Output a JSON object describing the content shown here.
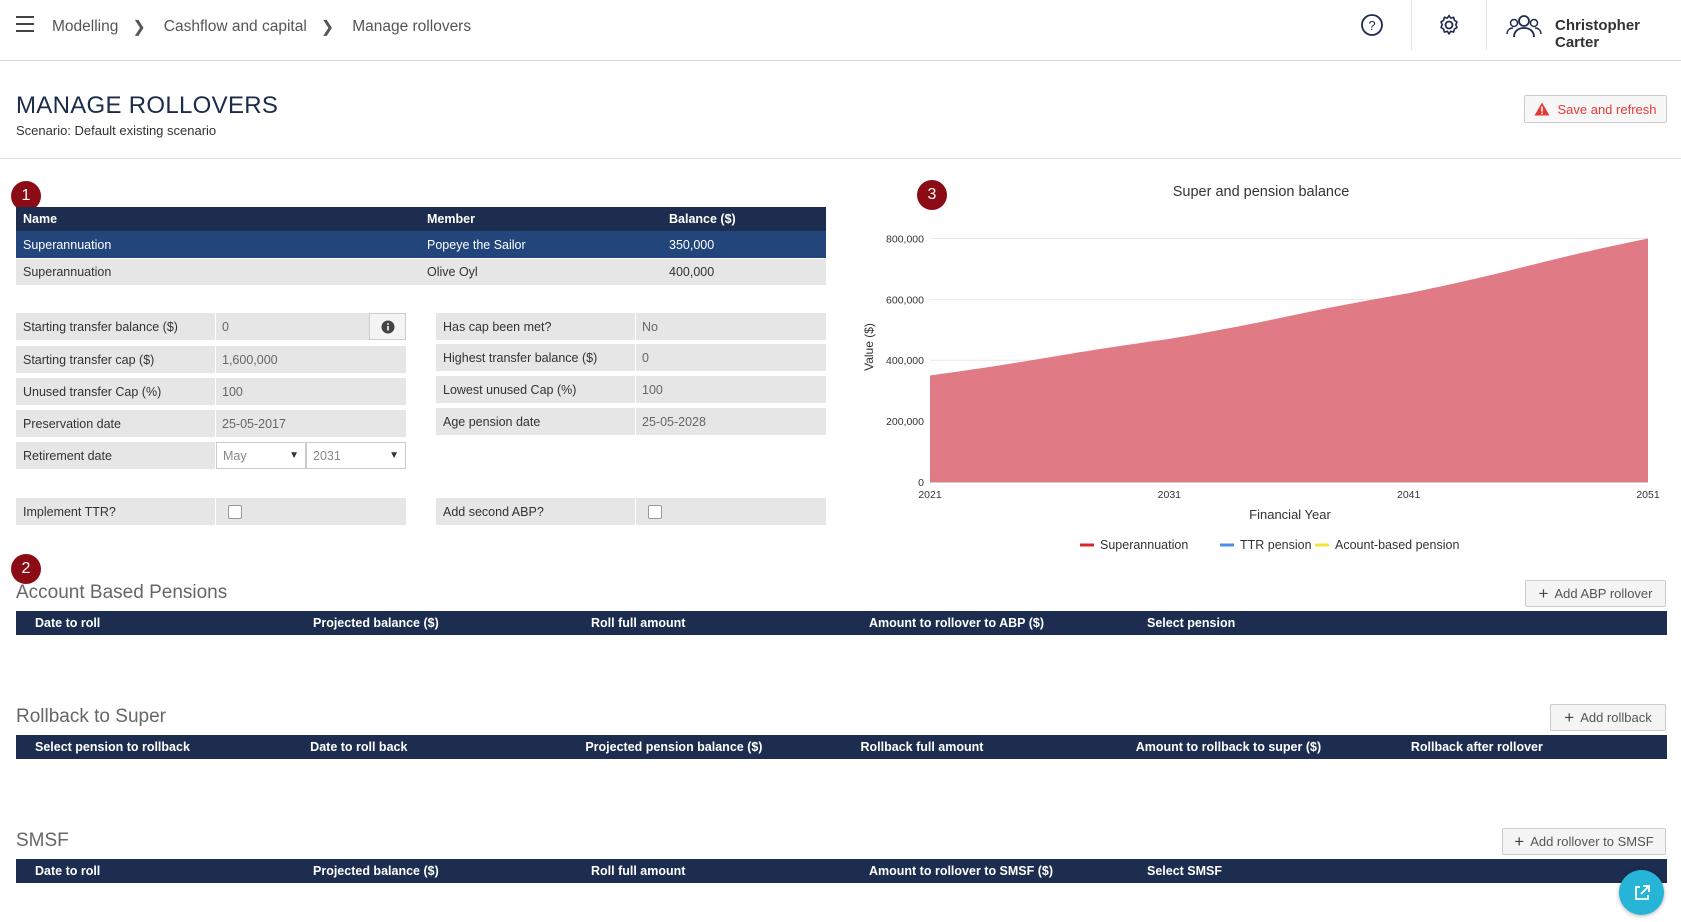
{
  "topbar": {
    "breadcrumb": [
      "Modelling",
      "Cashflow and capital",
      "Manage rollovers"
    ],
    "user_name": "Christopher Carter"
  },
  "page": {
    "title": "MANAGE ROLLOVERS",
    "subtitle": "Scenario: Default existing scenario",
    "save_label": "Save and refresh",
    "accent_warning": "#e53935"
  },
  "steps": [
    "1",
    "2",
    "3"
  ],
  "accounts": {
    "headers": [
      "Name",
      "Member",
      "Balance ($)"
    ],
    "rows": [
      {
        "name": "Superannuation",
        "member": "Popeye the Sailor",
        "balance": "350,000",
        "selected": true
      },
      {
        "name": "Superannuation",
        "member": "Olive Oyl",
        "balance": "400,000",
        "selected": false
      }
    ]
  },
  "fields_left": {
    "starting_transfer_balance": {
      "label": "Starting transfer balance ($)",
      "value": "0"
    },
    "starting_transfer_cap": {
      "label": "Starting transfer cap ($)",
      "value": "1,600,000"
    },
    "unused_transfer_cap": {
      "label": "Unused transfer Cap (%)",
      "value": "100"
    },
    "preservation_date": {
      "label": "Preservation date",
      "value": "25-05-2017"
    },
    "retirement_date": {
      "label": "Retirement date",
      "month": "May",
      "year": "2031"
    },
    "implement_ttr": {
      "label": "Implement TTR?"
    }
  },
  "fields_right": {
    "has_cap_been_met": {
      "label": "Has cap been met?",
      "value": "No"
    },
    "highest_transfer_balance": {
      "label": "Highest transfer balance ($)",
      "value": "0"
    },
    "lowest_unused_cap": {
      "label": "Lowest unused Cap (%)",
      "value": "100"
    },
    "age_pension_date": {
      "label": "Age pension date",
      "value": "25-05-2028"
    },
    "add_second_abp": {
      "label": "Add second ABP?"
    }
  },
  "chart_data": {
    "type": "area",
    "title": "Super and pension balance",
    "xlabel": "Financial Year",
    "ylabel": "Value ($)",
    "x": [
      2021,
      2031,
      2041,
      2051
    ],
    "x_ticks": [
      "2021",
      "2031",
      "2041",
      "2051"
    ],
    "y_ticks": [
      "0",
      "200,000",
      "400,000",
      "600,000",
      "800,000"
    ],
    "ylim": [
      0,
      900000
    ],
    "grid": true,
    "legend_position": "bottom",
    "series": [
      {
        "name": "Superannuation",
        "color": "#d9272e",
        "fill": "#e07b85",
        "values": [
          350000,
          470000,
          620000,
          800000
        ]
      },
      {
        "name": "TTR pension",
        "color": "#4a90e2",
        "values": [
          0,
          0,
          0,
          0
        ]
      },
      {
        "name": "Acount-based pension",
        "color": "#f2e632",
        "values": [
          0,
          0,
          0,
          0
        ]
      }
    ]
  },
  "abp": {
    "title": "Account Based Pensions",
    "add_label": "Add ABP rollover",
    "columns": [
      "Date to roll",
      "Projected balance ($)",
      "Roll full amount",
      "Amount to rollover to ABP ($)",
      "Select pension"
    ]
  },
  "rollback": {
    "title": "Rollback to Super",
    "add_label": "Add rollback",
    "columns": [
      "Select pension to rollback",
      "Date to roll back",
      "Projected pension balance ($)",
      "Rollback full amount",
      "Amount to rollback to super ($)",
      "Rollback after rollover"
    ]
  },
  "smsf": {
    "title": "SMSF",
    "add_label": "Add rollover to SMSF",
    "columns": [
      "Date to roll",
      "Projected balance ($)",
      "Roll full amount",
      "Amount to rollover to SMSF ($)",
      "Select SMSF"
    ]
  }
}
